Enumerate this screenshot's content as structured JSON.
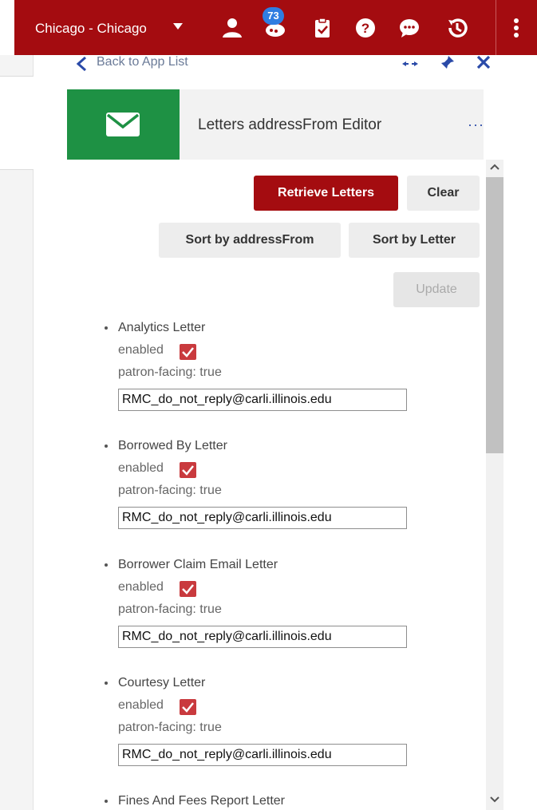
{
  "topbar": {
    "institution": "Chicago - Chicago",
    "notifications_count": "73",
    "icons": [
      "user-icon",
      "notifications-icon",
      "tasks-icon",
      "help-icon",
      "chat-icon",
      "history-icon",
      "more-vertical-icon"
    ]
  },
  "nav": {
    "back_label": "Back to App List"
  },
  "app": {
    "title": "Letters addressFrom Editor",
    "more_label": "···",
    "tile_icon": "envelope-icon",
    "tile_color": "#1e9144"
  },
  "buttons": {
    "retrieve": "Retrieve Letters",
    "clear": "Clear",
    "sort_address": "Sort by addressFrom",
    "sort_letter": "Sort by Letter",
    "update": "Update"
  },
  "letters": [
    {
      "name": "Analytics Letter",
      "enabled_label": "enabled",
      "enabled": true,
      "patron_facing": "patron-facing: true",
      "address": "RMC_do_not_reply@carli.illinois.edu"
    },
    {
      "name": "Borrowed By Letter",
      "enabled_label": "enabled",
      "enabled": true,
      "patron_facing": "patron-facing: true",
      "address": "RMC_do_not_reply@carli.illinois.edu"
    },
    {
      "name": "Borrower Claim Email Letter",
      "enabled_label": "enabled",
      "enabled": true,
      "patron_facing": "patron-facing: true",
      "address": "RMC_do_not_reply@carli.illinois.edu"
    },
    {
      "name": "Courtesy Letter",
      "enabled_label": "enabled",
      "enabled": true,
      "patron_facing": "patron-facing: true",
      "address": "RMC_do_not_reply@carli.illinois.edu"
    },
    {
      "name": "Fines And Fees Report Letter"
    }
  ],
  "colors": {
    "brand": "#a40c10",
    "checkbox": "#c93a3e",
    "link": "#2a4aa8"
  }
}
